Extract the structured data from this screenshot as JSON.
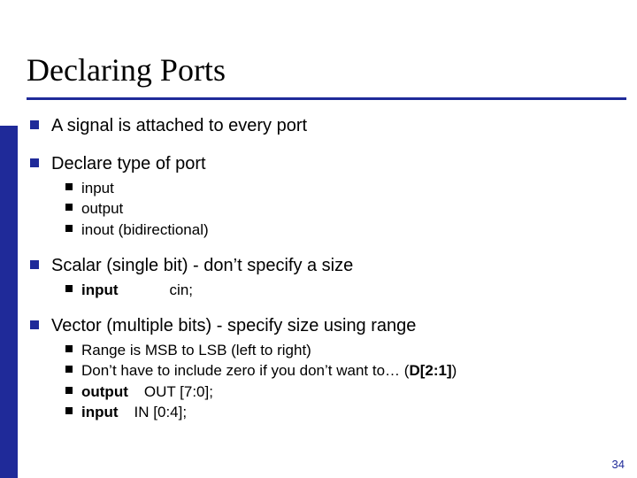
{
  "title": "Declaring Ports",
  "bullets": {
    "b1": "A signal is attached to every port",
    "b2": "Declare type of port",
    "b2s": {
      "i": "input",
      "o": "output",
      "io": "inout (bidirectional)"
    },
    "b3": "Scalar (single bit) - don’t specify a size",
    "b3s": {
      "kw": "input",
      "rest": "cin;"
    },
    "b4": "Vector (multiple bits) - specify size using range",
    "b4s": {
      "l1": "Range is MSB to LSB (left to right)",
      "l2a": "Don’t have to include zero if you don’t want to… (",
      "l2b": "D[2:1]",
      "l2c": ")",
      "l3kw": "output",
      "l3rest": "OUT [7:0];",
      "l4kw": "input",
      "l4rest": "IN [0:4];"
    }
  },
  "page_number": "34"
}
